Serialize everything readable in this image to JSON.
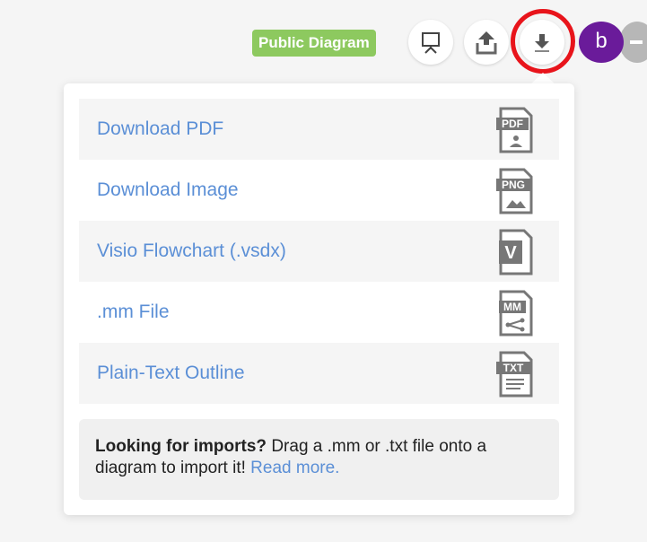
{
  "toolbar": {
    "badge_label": "Public Diagram",
    "buttons": [
      {
        "name": "present",
        "icon": "presentation-icon"
      },
      {
        "name": "share",
        "icon": "upload-icon"
      },
      {
        "name": "download",
        "icon": "download-icon"
      }
    ],
    "avatar_letter": "b",
    "colors": {
      "badge": "#8dc95f",
      "highlight": "#e8141b",
      "avatar": "#6a1b9a"
    }
  },
  "download_menu": {
    "items": [
      {
        "label": "Download PDF",
        "icon_text": "PDF",
        "icon": "pdf-file-icon"
      },
      {
        "label": "Download Image",
        "icon_text": "PNG",
        "icon": "png-file-icon"
      },
      {
        "label": "Visio Flowchart (.vsdx)",
        "icon_text": "V",
        "icon": "visio-file-icon"
      },
      {
        "label": ".mm File",
        "icon_text": "MM",
        "icon": "mm-file-icon"
      },
      {
        "label": "Plain-Text Outline",
        "icon_text": "TXT",
        "icon": "txt-file-icon"
      }
    ],
    "link_color": "#5b8fd6"
  },
  "imports_note": {
    "heading": "Looking for imports?",
    "body": " Drag a .mm or .txt file onto a diagram to import it! ",
    "link": "Read more."
  }
}
